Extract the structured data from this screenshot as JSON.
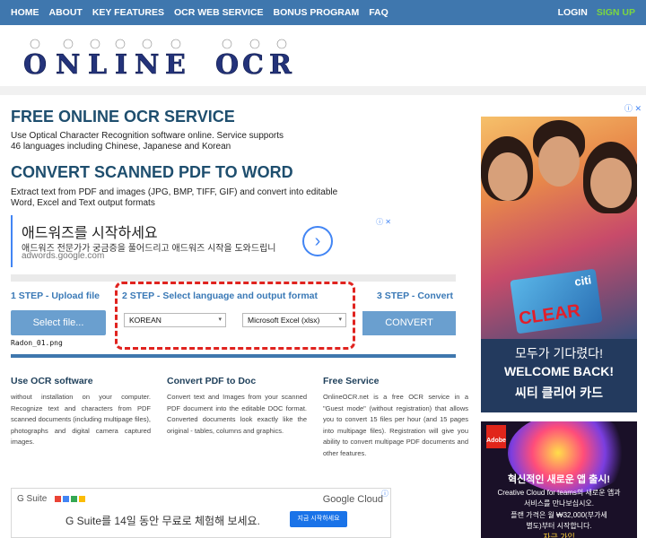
{
  "nav": {
    "left": [
      "HOME",
      "ABOUT",
      "KEY FEATURES",
      "OCR WEB SERVICE",
      "BONUS PROGRAM",
      "FAQ"
    ],
    "login": "LOGIN",
    "signup": "SIGN UP"
  },
  "logo": {
    "text": "ONLINE OCR"
  },
  "main": {
    "h1": "FREE ONLINE OCR SERVICE",
    "p1a": "Use Optical Character Recognition software online. Service supports",
    "p1b": "46 languages including Chinese, Japanese and Korean",
    "h2": "CONVERT SCANNED PDF TO WORD",
    "p2a": "Extract text from PDF and images (JPG, BMP, TIFF, GIF) and convert into editable",
    "p2b": "Word, Excel and Text output formats"
  },
  "ad_adwords": {
    "title": "애드워즈를 시작하세요",
    "subtitle": "애드워즈 전문가가 궁금증을 풀어드리고 애드워즈 시작을 도와드립니",
    "url": "adwords.google.com",
    "arrow": "›",
    "adchoice": "ⓘ ✕"
  },
  "steps": {
    "step1_title": "1 STEP - Upload file",
    "step1_button": "Select file...",
    "filename": "Radon_01.png",
    "step2_title": "2 STEP - Select language and output format",
    "language": "KOREAN",
    "format": "Microsoft Excel (xlsx)",
    "caret": "▾",
    "step3_title": "3 STEP - Convert",
    "convert_button": "CONVERT"
  },
  "info": {
    "c1_title": "Use OCR software",
    "c1_text": "without installation on your computer. Recognize text and characters from PDF scanned documents (including multipage files), photographs and digital camera captured images.",
    "c2_title": "Convert PDF to Doc",
    "c2_text": "Convert text and Images from your scanned PDF document into the editable DOC format. Converted documents look exactly like the original - tables, columns and graphics.",
    "c3_title": "Free Service",
    "c3_text": "OnlineOCR.net is a free OCR service in a \"Guest mode\" (without registration) that allows you to convert 15 files per hour (and 15 pages into multipage files). Registration will give you ability to convert multipage PDF documents and other features."
  },
  "ad_gsuite": {
    "label": "G Suite",
    "brand": "Google Cloud",
    "text": "G Suite를 14일 동안 무료로 체험해 보세요.",
    "button": "지금 시작하세요",
    "adchoice": "ⓘ"
  },
  "ad_side1": {
    "card_brand": "citi",
    "card_big": "CLEAR",
    "line1": "모두가 기다렸다!",
    "line2": "WELCOME BACK!",
    "line3": "씨티 클리어 카드",
    "info": "ⓘ ✕"
  },
  "ad_side2": {
    "logo": "Adobe",
    "headline": "혁신적인 새로운 앱 출시!",
    "s1": "Creative Cloud for teams의 새로운 앱과",
    "s2": "서비스를 만나보십시오.",
    "s3": "플랜 가격은 월 ₩32,000(부가세",
    "s4": "별도)부터 시작합니다.",
    "link": "자금 가입"
  },
  "colors": {
    "nav": "#3f77ae",
    "heading": "#1e4e6e",
    "step": "#3a79b6",
    "button": "#6a9fcf",
    "highlight": "#e0231f",
    "signup": "#7bd641"
  }
}
